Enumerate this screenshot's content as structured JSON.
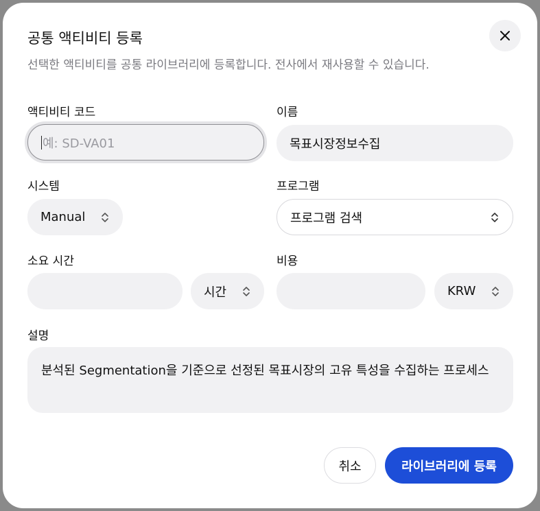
{
  "dialog": {
    "title": "공통 액티비티 등록",
    "subtitle": "선택한 액티비티를 공통 라이브러리에 등록합니다. 전사에서 재사용할 수 있습니다."
  },
  "fields": {
    "code": {
      "label": "액티비티 코드",
      "placeholder": "예: SD-VA01",
      "value": ""
    },
    "name": {
      "label": "이름",
      "value": "목표시장정보수집"
    },
    "system": {
      "label": "시스템",
      "value": "Manual"
    },
    "program": {
      "label": "프로그램",
      "placeholder": "프로그램 검색"
    },
    "duration": {
      "label": "소요 시간",
      "value": "",
      "unit": "시간"
    },
    "cost": {
      "label": "비용",
      "value": "",
      "currency": "KRW"
    },
    "description": {
      "label": "설명",
      "value": "분석된 Segmentation을 기준으로 선정된 목표시장의 고유 특성을 수집하는 프로세스"
    }
  },
  "actions": {
    "cancel_label": "취소",
    "submit_label": "라이브러리에 등록"
  },
  "colors": {
    "primary": "#1d4ed8",
    "field_bg": "#f1f1f3",
    "subtitle": "#7a7a80"
  },
  "icons": {
    "close": "close-icon",
    "select": "chevron-up-down-icon"
  }
}
